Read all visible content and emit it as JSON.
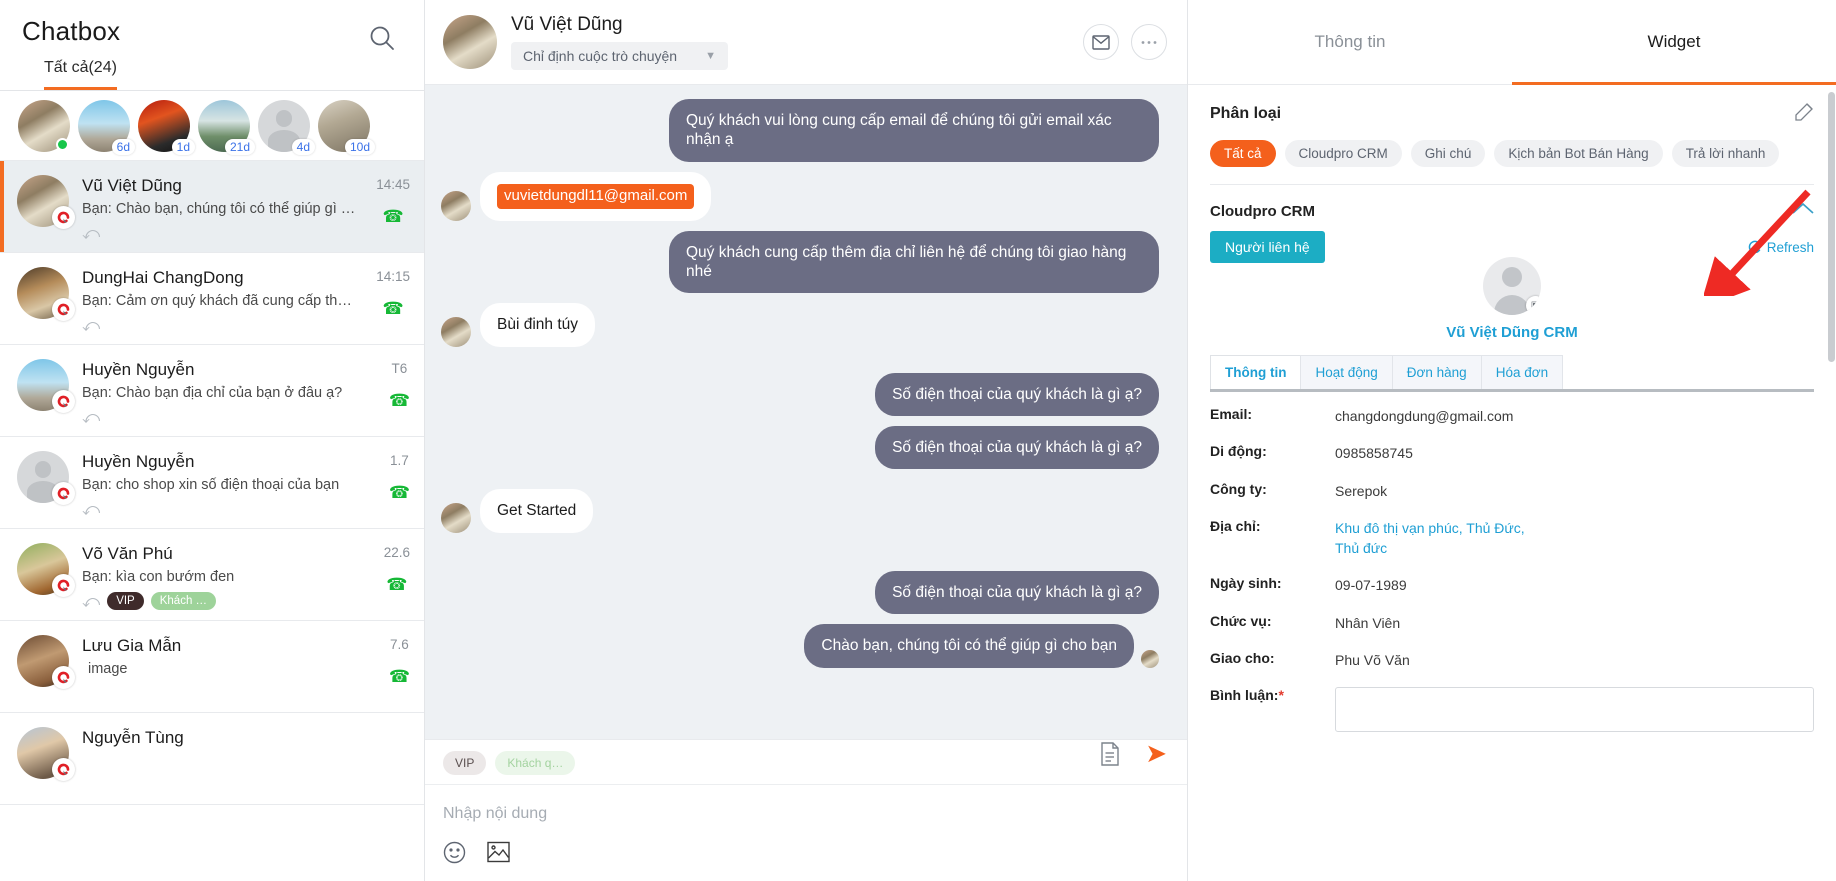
{
  "left_panel": {
    "title": "Chatbox",
    "tab_all": "Tất cả(24)",
    "search_icon": "search-icon",
    "stories": [
      {
        "badge": "",
        "online": true
      },
      {
        "badge": "6d",
        "online": false
      },
      {
        "badge": "1d",
        "online": false
      },
      {
        "badge": "21d",
        "online": false
      },
      {
        "badge": "4d",
        "online": false
      },
      {
        "badge": "10d",
        "online": false
      }
    ],
    "conversations": [
      {
        "name": "Vũ Việt Dũng",
        "snippet": "Bạn: Chào bạn, chúng tôi có thể giúp gì ch…",
        "time": "14:45",
        "tags": [],
        "active": true
      },
      {
        "name": "DungHai ChangDong",
        "snippet": "Bạn: Cảm ơn quý khách đã cung cấp thông…",
        "time": "14:15",
        "tags": [],
        "active": false
      },
      {
        "name": "Huyền Nguyễn",
        "snippet": "Bạn: Chào bạn địa chỉ của bạn ở đâu ạ?",
        "time": "T6",
        "tags": [],
        "active": false
      },
      {
        "name": "Huyền Nguyễn",
        "snippet": "Bạn: cho shop xin số điện thoại của bạn",
        "time": "1.7",
        "tags": [],
        "active": false
      },
      {
        "name": "Võ Văn Phú",
        "snippet": "Bạn: kìa con bướm đen",
        "time": "22.6",
        "tags": [
          "VIP",
          "Khách …"
        ],
        "active": false
      },
      {
        "name": "Lưu Gia Mẫn",
        "snippet": "image",
        "time": "7.6",
        "tags": [],
        "active": false
      },
      {
        "name": "Nguyễn Tùng",
        "snippet": "",
        "time": "",
        "tags": [],
        "active": false
      }
    ]
  },
  "chat": {
    "contact_name": "Vũ Việt Dũng",
    "assign_label": "Chỉ định cuộc trò chuyện",
    "mail_icon": "mail-icon",
    "more_icon": "more-horizontal-icon",
    "messages": [
      {
        "dir": "out",
        "text": "Quý khách vui lòng cung cấp email để chúng tôi gửi email xác nhận ạ"
      },
      {
        "dir": "in",
        "type": "chip",
        "text": "vuvietdungdl11@gmail.com"
      },
      {
        "dir": "out",
        "text": "Quý khách cung cấp thêm địa chỉ liên hệ để chúng tôi giao hàng nhé"
      },
      {
        "dir": "in",
        "text": "Bùi đinh túy"
      },
      {
        "dir": "out",
        "text": "Số điện thoại của quý khách là gì ạ?"
      },
      {
        "dir": "out",
        "text": "Số điện thoại của quý khách là gì ạ?"
      },
      {
        "dir": "in",
        "text": "Get Started"
      },
      {
        "dir": "out",
        "text": "Số điện thoại của quý khách là gì ạ?"
      },
      {
        "dir": "out",
        "text": "Chào bạn, chúng tôi có thể giúp gì cho bạn",
        "seen": true
      }
    ],
    "composer": {
      "tags": [
        "VIP",
        "Khách q…"
      ],
      "placeholder": "Nhập nội dung",
      "emoji_icon": "emoji-icon",
      "image_icon": "image-icon",
      "template_icon": "document-icon",
      "send_icon": "send-icon"
    }
  },
  "right_panel": {
    "tabs": [
      {
        "label": "Thông tin",
        "active": false
      },
      {
        "label": "Widget",
        "active": true
      }
    ],
    "classify": {
      "title": "Phân loại",
      "edit_icon": "edit-icon",
      "chips": [
        {
          "label": "Tất cả",
          "selected": true
        },
        {
          "label": "Cloudpro CRM",
          "selected": false
        },
        {
          "label": "Ghi chú",
          "selected": false
        },
        {
          "label": "Kịch bản Bot Bán Hàng",
          "selected": false
        },
        {
          "label": "Trả lời nhanh",
          "selected": false
        }
      ]
    },
    "crm": {
      "title": "Cloudpro CRM",
      "collapse_icon": "chevron-up-icon",
      "contact_button": "Người liên hệ",
      "refresh_label": "Refresh",
      "refresh_icon": "refresh-icon",
      "avatar_camera_icon": "camera-icon",
      "contact_name": "Vũ Việt Dũng CRM",
      "tabs": [
        {
          "label": "Thông tin",
          "active": true
        },
        {
          "label": "Hoạt động",
          "active": false
        },
        {
          "label": "Đơn hàng",
          "active": false
        },
        {
          "label": "Hóa đơn",
          "active": false
        }
      ],
      "fields": [
        {
          "label": "Email:",
          "value": "changdongdung@gmail.com",
          "link": false
        },
        {
          "label": "Di động:",
          "value": "0985858745",
          "link": false
        },
        {
          "label": "Công ty:",
          "value": "Serepok",
          "link": false
        },
        {
          "label": "Địa chỉ:",
          "value": "Khu đô thị vạn phúc, Thủ Đức, Thủ đức",
          "link": true
        },
        {
          "label": "Ngày sinh:",
          "value": "09-07-1989",
          "link": false
        },
        {
          "label": "Chức vụ:",
          "value": "Nhân Viên",
          "link": false
        },
        {
          "label": "Giao cho:",
          "value": "Phu Võ Văn",
          "link": false
        }
      ],
      "comment_label": "Bình luận:",
      "comment_required": "*",
      "comment_value": ""
    }
  },
  "colors": {
    "accent_orange": "#f36c21",
    "bubble_out": "#6b6d84",
    "crm_blue": "#1f9fd4",
    "contact_teal": "#1cadc4",
    "annotation_red": "#ee2a24"
  }
}
